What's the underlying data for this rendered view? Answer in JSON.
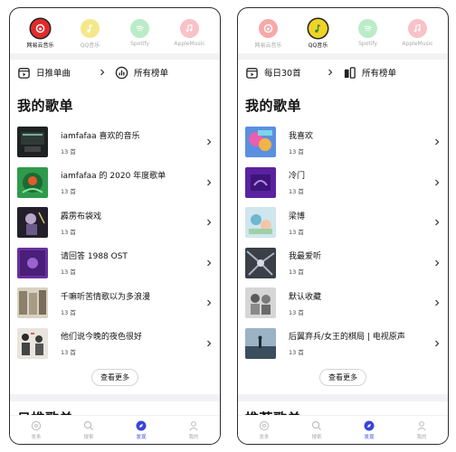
{
  "left": {
    "sources": [
      {
        "label": "网易云音乐",
        "color": "#e02b2b",
        "active": true,
        "icon": "netease-icon"
      },
      {
        "label": "QQ音乐",
        "color": "#f5e88a",
        "active": false,
        "icon": "qqmusic-icon"
      },
      {
        "label": "Spotify",
        "color": "#b9ecc7",
        "active": false,
        "icon": "spotify-icon"
      },
      {
        "label": "AppleMusic",
        "color": "#f9c1c8",
        "active": false,
        "icon": "applemusic-icon"
      }
    ],
    "quick": [
      {
        "label": "日推单曲",
        "icon": "daily-songs-icon"
      },
      {
        "label": "所有榜单",
        "icon": "charts-icon"
      }
    ],
    "section_title": "我的歌单",
    "playlists": [
      {
        "title": "iamfafaa 喜欢的音乐",
        "count": "13 首"
      },
      {
        "title": "iamfafaa 的 2020 年度歌单",
        "count": "13 首"
      },
      {
        "title": "霹雳布袋戏",
        "count": "13 首"
      },
      {
        "title": "请回答 1988 OST",
        "count": "13 首"
      },
      {
        "title": "千嘛听苦情歌以为多浪漫",
        "count": "13 首"
      },
      {
        "title": "他们说今晚的夜色很好",
        "count": "13 首"
      }
    ],
    "more_label": "查看更多",
    "next_section_title": "日推歌单"
  },
  "right": {
    "sources": [
      {
        "label": "网易云音乐",
        "color": "#f6a9a9",
        "active": false,
        "icon": "netease-icon"
      },
      {
        "label": "QQ音乐",
        "color": "#f0d327",
        "active": true,
        "icon": "qqmusic-icon"
      },
      {
        "label": "Spotify",
        "color": "#b9ecc7",
        "active": false,
        "icon": "spotify-icon"
      },
      {
        "label": "AppleMusic",
        "color": "#f9c1c8",
        "active": false,
        "icon": "applemusic-icon"
      }
    ],
    "quick": [
      {
        "label": "每日30首",
        "icon": "daily-songs-icon"
      },
      {
        "label": "所有榜单",
        "icon": "charts-icon"
      }
    ],
    "section_title": "我的歌单",
    "playlists": [
      {
        "title": "我喜欢",
        "count": "13 首"
      },
      {
        "title": "冷门",
        "count": "13 首"
      },
      {
        "title": "梁博",
        "count": "13 首"
      },
      {
        "title": "我最爱听",
        "count": "13 首"
      },
      {
        "title": "默认收藏",
        "count": "13 首"
      },
      {
        "title": "后翼弃兵/女王的棋局 | 电视原声",
        "count": "13 首"
      }
    ],
    "more_label": "查看更多",
    "next_section_title": "推荐歌单"
  },
  "tabs": [
    {
      "label": "发条",
      "icon": "wind-up-icon",
      "active": false
    },
    {
      "label": "搜索",
      "icon": "search-icon",
      "active": false
    },
    {
      "label": "发现",
      "icon": "discover-icon",
      "active": true
    },
    {
      "label": "我的",
      "icon": "profile-icon",
      "active": false
    }
  ],
  "colors": {
    "accent": "#3a46d8",
    "band": "#f2f2f4"
  }
}
